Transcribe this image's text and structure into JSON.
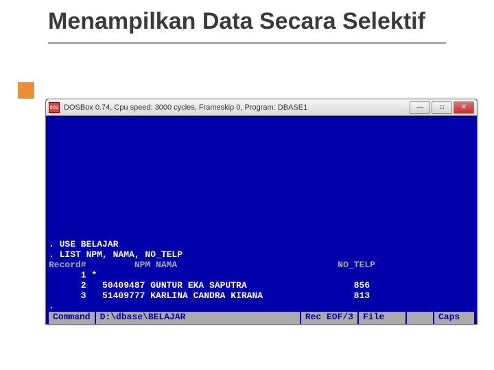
{
  "slide": {
    "title": "Menampilkan Data Secara Selektif"
  },
  "window": {
    "icon_label": "DOS",
    "title": "DOSBox 0.74, Cpu speed:    3000 cycles, Frameskip  0, Program:   DBASE1",
    "controls": {
      "min": "—",
      "max": "□",
      "close": "✕"
    }
  },
  "terminal": {
    "lines": {
      "l1": ". USE BELAJAR",
      "l2": ". LIST NPM, NAMA, NO_TELP",
      "hdr": "Record#         NPM NAMA                              NO_TELP",
      "r1": "      1 *",
      "r2": "      2   50409487 GUNTUR EKA SAPUTRA                    856",
      "r3": "      3   51409777 KARLINA CANDRA KIRANA                 813",
      "dot": "."
    }
  },
  "statusbar": {
    "command_label": "Command",
    "path": "D:\\dbase\\BELAJAR",
    "rec": "Rec EOF/3",
    "file": "File",
    "caps": "Caps"
  }
}
